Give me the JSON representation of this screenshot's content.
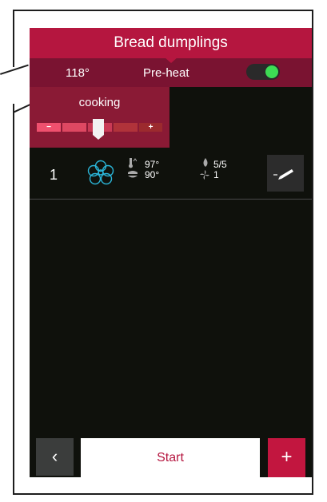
{
  "header": {
    "title": "Bread dumplings"
  },
  "status": {
    "temperature": "118°",
    "mode": "Pre-heat",
    "preheat_enabled": true
  },
  "cooking": {
    "label": "cooking",
    "minus_label": "−",
    "plus_label": "+",
    "level": 0.5
  },
  "steps": [
    {
      "number": "1",
      "mode_icon": "fan-steam-icon",
      "core_temp": "97°",
      "cabinet_temp": "90°",
      "humidity": "5/5",
      "fan_speed": "1"
    }
  ],
  "footer": {
    "back_label": "‹",
    "start_label": "Start",
    "add_label": "+"
  },
  "colors": {
    "accent": "#b5163f",
    "accent_dark": "#7a1331",
    "panel": "#8a1a35",
    "background": "#0f110c",
    "toggle_on": "#3ddc54",
    "mode_icon": "#2bb5d8"
  }
}
